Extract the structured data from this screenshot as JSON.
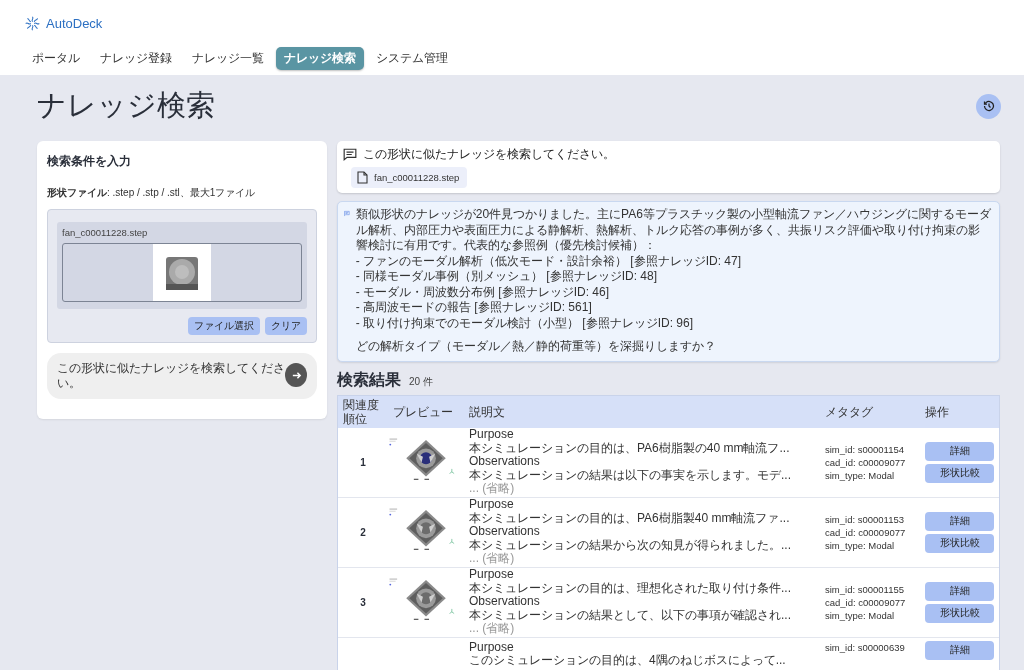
{
  "brand": {
    "name": "AutoDeck"
  },
  "nav": [
    {
      "label": "ポータル",
      "selected": false
    },
    {
      "label": "ナレッジ登録",
      "selected": false
    },
    {
      "label": "ナレッジ一覧",
      "selected": false
    },
    {
      "label": "ナレッジ検索",
      "selected": true
    },
    {
      "label": "システム管理",
      "selected": false
    }
  ],
  "page_title": "ナレッジ検索",
  "search_panel": {
    "title": "検索条件を入力",
    "file_hint_label": "形状ファイル",
    "file_hint": ": .step / .stp / .stl、最大1ファイル",
    "file_name": "fan_c00011228.step",
    "buttons": [
      "ファイル選択",
      "クリア"
    ],
    "query": "この形状に似たナレッジを検索してください。"
  },
  "user_message": {
    "text": "この形状に似たナレッジを検索してください。",
    "attachment": "fan_c00011228.step"
  },
  "assistant_message": {
    "summary": "類似形状のナレッジが20件見つかりました。主にPA6等プラスチック製の小型軸流ファン／ハウジングに関するモーダル解析、内部圧力や表面圧力による静解析、熱解析、トルク応答の事例が多く、共振リスク評価や取り付け拘束の影響検討に有用です。代表的な参照例（優先検討候補）：",
    "references": [
      "- ファンのモーダル解析（低次モード・設計余裕） [参照ナレッジID: 47]",
      "- 同様モーダル事例（別メッシュ） [参照ナレッジID: 48]",
      "- モーダル・周波数分布例 [参照ナレッジID: 46]",
      "- 高周波モードの報告 [参照ナレッジID: 561]",
      "- 取り付け拘束でのモーダル検討（小型） [参照ナレッジID: 96]"
    ],
    "question": "どの解析タイプ（モーダル／熱／静的荷重等）を深掘りしますか？"
  },
  "results": {
    "title": "検索結果",
    "count": "20 件",
    "columns": [
      "関連度順位",
      "プレビュー",
      "説明文",
      "メタタグ",
      "操作"
    ],
    "rows": [
      {
        "rank": "1",
        "highlight": true,
        "description": [
          "Purpose",
          "本シミュレーションの目的は、PA6樹脂製の40 mm軸流フ...",
          "Observations",
          "本シミュレーションの結果は以下の事実を示します。モデ...",
          "... (省略)"
        ],
        "meta": [
          "sim_id: s00001154",
          "cad_id: c00009077",
          "sim_type: Modal"
        ],
        "actions": [
          "詳細",
          "形状比較"
        ]
      },
      {
        "rank": "2",
        "highlight": false,
        "description": [
          "Purpose",
          "本シミュレーションの目的は、PA6樹脂製40 mm軸流ファ...",
          "Observations",
          "本シミュレーションの結果から次の知見が得られました。...",
          "... (省略)"
        ],
        "meta": [
          "sim_id: s00001153",
          "cad_id: c00009077",
          "sim_type: Modal"
        ],
        "actions": [
          "詳細",
          "形状比較"
        ]
      },
      {
        "rank": "3",
        "highlight": false,
        "description": [
          "Purpose",
          "本シミュレーションの目的は、理想化された取り付け条件...",
          "Observations",
          "本シミュレーションの結果として、以下の事項が確認され...",
          "... (省略)"
        ],
        "meta": [
          "sim_id: s00001155",
          "cad_id: c00009077",
          "sim_type: Modal"
        ],
        "actions": [
          "詳細",
          "形状比較"
        ]
      },
      {
        "description": [
          "Purpose",
          "このシミュレーションの目的は、4隅のねじボスによって..."
        ],
        "meta": [
          "sim_id: s00000639"
        ],
        "actions": [
          "詳細"
        ]
      }
    ]
  }
}
